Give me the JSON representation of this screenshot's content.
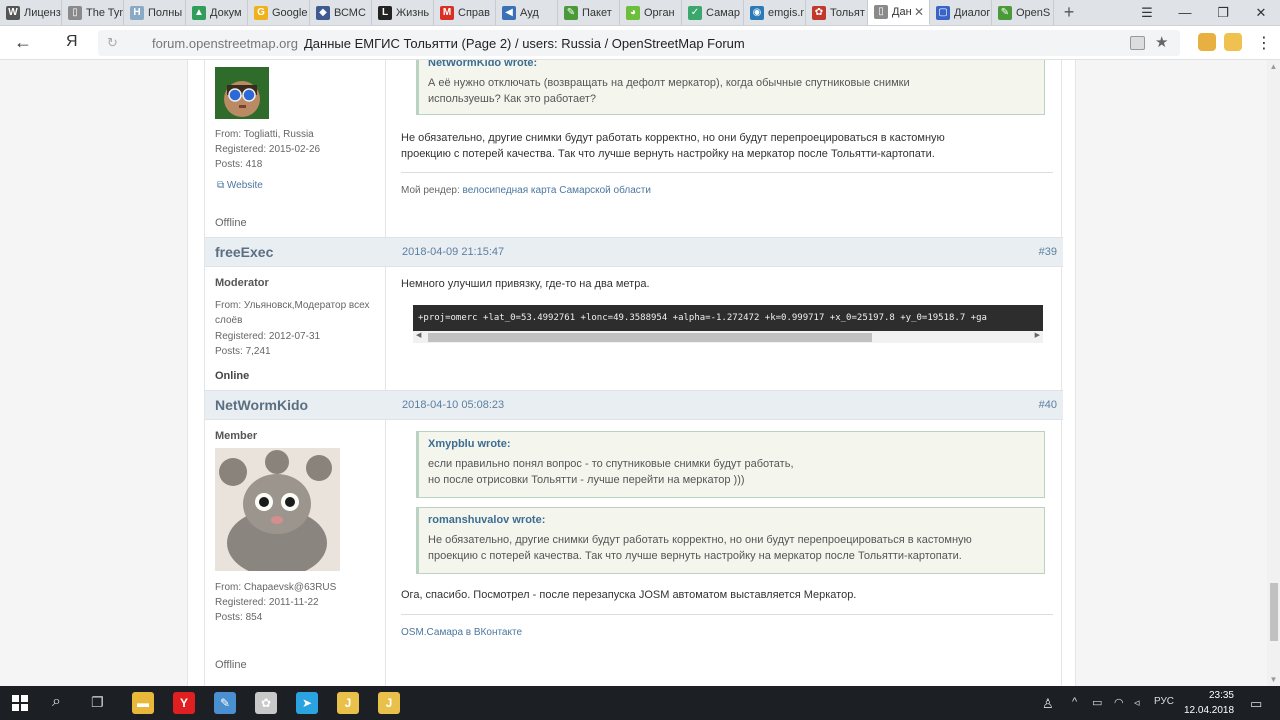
{
  "browser": {
    "tabs": [
      {
        "label": "Лиценз",
        "icon": "W",
        "color": "#555555"
      },
      {
        "label": "The Tyn",
        "icon": "▯",
        "color": "#8a8a8a"
      },
      {
        "label": "Полны",
        "icon": "H",
        "color": "#8aa9c5"
      },
      {
        "label": "Докум",
        "icon": "▲",
        "color": "#2f9e5a"
      },
      {
        "label": "Google",
        "icon": "G",
        "color": "#f0b21c"
      },
      {
        "label": "ВСМС",
        "icon": "◆",
        "color": "#3f5b8f"
      },
      {
        "label": "Жизнь",
        "icon": "L",
        "color": "#222222"
      },
      {
        "label": "Справ",
        "icon": "M",
        "color": "#d93025"
      },
      {
        "label": "Ауд",
        "icon": "◀",
        "color": "#3b6fb6"
      },
      {
        "label": "Пакет",
        "icon": "✎",
        "color": "#4a9a3a"
      },
      {
        "label": "Орган",
        "icon": "◕",
        "color": "#6cbf3a"
      },
      {
        "label": "Самар",
        "icon": "✓",
        "color": "#3aa76d"
      },
      {
        "label": "emgis.r",
        "icon": "◉",
        "color": "#2a7ab8"
      },
      {
        "label": "Тольят",
        "icon": "✿",
        "color": "#c0392b"
      },
      {
        "label": "Дан",
        "icon": "▯",
        "color": "#8a8a8a",
        "active": true
      },
      {
        "label": "Диалог",
        "icon": "▢",
        "color": "#3a63c6"
      },
      {
        "label": "OpenS",
        "icon": "✎",
        "color": "#4a9a3a"
      }
    ],
    "new_tab_glyph": "+",
    "menu_glyph": "☰",
    "minimize_glyph": "—",
    "restore_glyph": "❐",
    "close_glyph": "✕",
    "back_glyph": "←",
    "yandex_glyph": "Я",
    "reload_glyph": "↻",
    "domain": "forum.openstreetmap.org",
    "page_title": "Данные ЕМГИС Тольятти (Page 2) / users: Russia / OpenStreetMap Forum",
    "star_glyph": "★",
    "menu_dots_glyph": "⋮"
  },
  "posts": {
    "p38": {
      "from": "From: Togliatti, Russia",
      "registered": "Registered: 2015-02-26",
      "posts_count": "Posts: 418",
      "website": "Website",
      "status": "Offline",
      "quote_author": "NetWormKido wrote:",
      "quote_text_1": "А её нужно отключать (возвращать на дефолт меркатор), когда обычные спутниковые снимки",
      "quote_text_2": "используешь? Как это работает?",
      "text_1": "Не обязательно, другие снимки будут работать корректно, но они будут перепроецироваться в кастомную",
      "text_2": "проекцию с потерей качества. Так что лучше вернуть настройку на меркатор после Тольятти-картопати.",
      "sig_prefix": "Мой рендер: ",
      "sig_link": "велосипедная карта Самарской области"
    },
    "p39": {
      "author": "freeExec",
      "date": "2018-04-09 21:15:47",
      "num": "#39",
      "role": "Moderator",
      "from_1": "From: Ульяновск,Модератор всех",
      "from_2": "слоёв",
      "registered": "Registered: 2012-07-31",
      "posts_count": "Posts: 7,241",
      "status": "Online",
      "text": "Немного улучшил привязку, где-то на два метра.",
      "code": "+proj=omerc +lat_0=53.4992761 +lonc=49.3588954 +alpha=-1.272472 +k=0.999717 +x_0=25197.8 +y_0=19518.7 +ga"
    },
    "p40": {
      "author": "NetWormKido",
      "date": "2018-04-10 05:08:23",
      "num": "#40",
      "role": "Member",
      "from": "From: Chapaevsk@63RUS",
      "registered": "Registered: 2011-11-22",
      "posts_count": "Posts: 854",
      "status": "Offline",
      "quote1_author": "Xmypblu wrote:",
      "quote1_text_1": "если правильно понял вопрос - то спутниковые снимки будут работать,",
      "quote1_text_2": "но после отрисовки Тольятти - лучше перейти на меркатор )))",
      "quote2_author": "romanshuvalov wrote:",
      "quote2_text_1": "Не обязательно, другие снимки будут работать корректно, но они будут перепроецироваться в кастомную",
      "quote2_text_2": "проекцию с потерей качества. Так что лучше вернуть настройку на меркатор после Тольятти-картопати.",
      "text": "Ога, спасибо. Посмотрел - после перезапуска JOSM автоматом выставляется Меркатор.",
      "sig_link": "OSM.Самара в ВКонтакте"
    }
  },
  "taskbar": {
    "search_glyph": "⌕",
    "task_view_glyph": "❐",
    "apps": [
      {
        "name": "file-explorer-icon",
        "glyph": "▬",
        "color": "#e8b83a"
      },
      {
        "name": "yandex-browser-icon",
        "glyph": "Y",
        "color": "#e02020"
      },
      {
        "name": "notepad-icon",
        "glyph": "✎",
        "color": "#4a8fd0"
      },
      {
        "name": "paint-icon",
        "glyph": "✿",
        "color": "#c8c8c8"
      },
      {
        "name": "telegram-icon",
        "glyph": "➤",
        "color": "#2aa3e0"
      },
      {
        "name": "josm-icon",
        "glyph": "J",
        "color": "#e8c04a"
      },
      {
        "name": "josm-icon-2",
        "glyph": "J",
        "color": "#e8c04a"
      }
    ],
    "tray_person": "♙",
    "tray_up": "^",
    "tray_battery": "▭",
    "tray_wifi": "◠",
    "tray_volume": "◃",
    "lang": "РУС",
    "time": "23:35",
    "date": "12.04.2018",
    "notif_glyph": "▭"
  }
}
